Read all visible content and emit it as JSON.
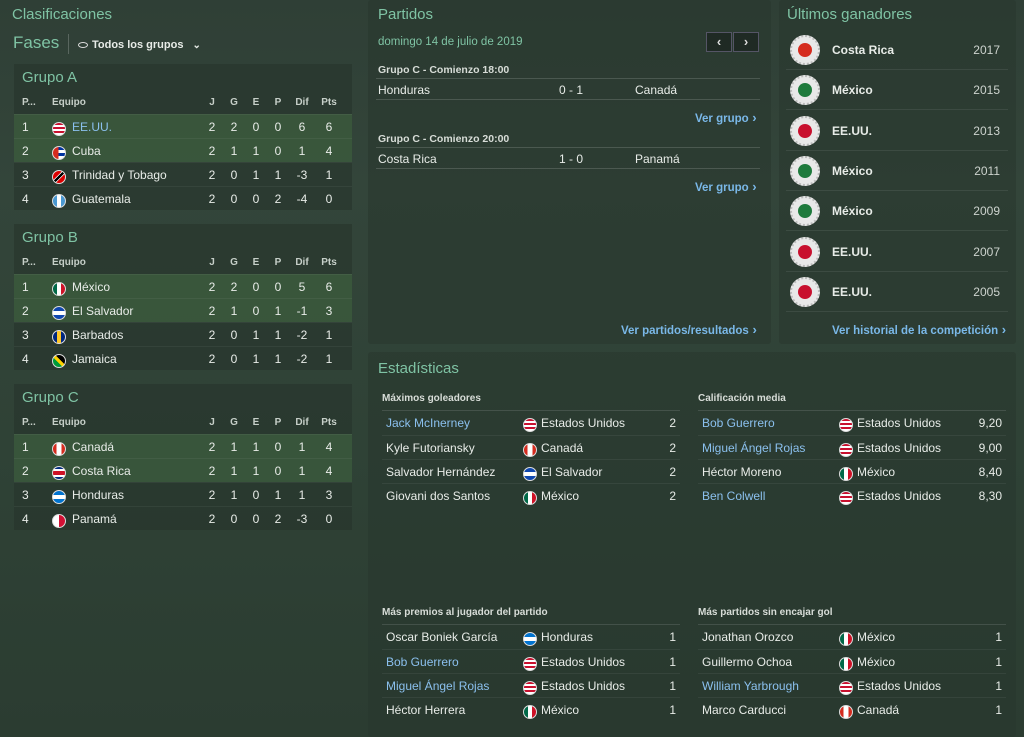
{
  "left": {
    "title": "Clasificaciones",
    "phases_label": "Fases",
    "filter_label": "Todos los grupos",
    "headers": {
      "pos": "P...",
      "team": "Equipo",
      "j": "J",
      "g": "G",
      "e": "E",
      "p": "P",
      "dif": "Dif",
      "pts": "Pts"
    },
    "groups": [
      {
        "name": "Grupo A",
        "rows": [
          {
            "pos": "1",
            "team": "EE.UU.",
            "flag": "usa",
            "j": "2",
            "g": "2",
            "e": "0",
            "p": "0",
            "dif": "6",
            "pts": "6",
            "q": true,
            "link": true
          },
          {
            "pos": "2",
            "team": "Cuba",
            "flag": "cuba",
            "j": "2",
            "g": "1",
            "e": "1",
            "p": "0",
            "dif": "1",
            "pts": "4",
            "q": true
          },
          {
            "pos": "3",
            "team": "Trinidad y Tobago",
            "flag": "tt",
            "j": "2",
            "g": "0",
            "e": "1",
            "p": "1",
            "dif": "-3",
            "pts": "1"
          },
          {
            "pos": "4",
            "team": "Guatemala",
            "flag": "gua",
            "j": "2",
            "g": "0",
            "e": "0",
            "p": "2",
            "dif": "-4",
            "pts": "0"
          }
        ]
      },
      {
        "name": "Grupo B",
        "rows": [
          {
            "pos": "1",
            "team": "México",
            "flag": "mex",
            "j": "2",
            "g": "2",
            "e": "0",
            "p": "0",
            "dif": "5",
            "pts": "6",
            "q": true
          },
          {
            "pos": "2",
            "team": "El Salvador",
            "flag": "slv",
            "j": "2",
            "g": "1",
            "e": "0",
            "p": "1",
            "dif": "-1",
            "pts": "3",
            "q": true
          },
          {
            "pos": "3",
            "team": "Barbados",
            "flag": "bar",
            "j": "2",
            "g": "0",
            "e": "1",
            "p": "1",
            "dif": "-2",
            "pts": "1"
          },
          {
            "pos": "4",
            "team": "Jamaica",
            "flag": "jam",
            "j": "2",
            "g": "0",
            "e": "1",
            "p": "1",
            "dif": "-2",
            "pts": "1"
          }
        ]
      },
      {
        "name": "Grupo C",
        "rows": [
          {
            "pos": "1",
            "team": "Canadá",
            "flag": "can",
            "j": "2",
            "g": "1",
            "e": "1",
            "p": "0",
            "dif": "1",
            "pts": "4",
            "q": true
          },
          {
            "pos": "2",
            "team": "Costa Rica",
            "flag": "crc",
            "j": "2",
            "g": "1",
            "e": "1",
            "p": "0",
            "dif": "1",
            "pts": "4",
            "q": true
          },
          {
            "pos": "3",
            "team": "Honduras",
            "flag": "hon",
            "j": "2",
            "g": "1",
            "e": "0",
            "p": "1",
            "dif": "1",
            "pts": "3"
          },
          {
            "pos": "4",
            "team": "Panamá",
            "flag": "pan",
            "j": "2",
            "g": "0",
            "e": "0",
            "p": "2",
            "dif": "-3",
            "pts": "0"
          }
        ]
      }
    ]
  },
  "matches": {
    "title": "Partidos",
    "date": "domingo 14 de julio de 2019",
    "prev": "‹",
    "next": "›",
    "games": [
      {
        "head": "Grupo C - Comienzo 18:00",
        "home": "Honduras",
        "score": "0 - 1",
        "away": "Canadá",
        "link": "Ver grupo"
      },
      {
        "head": "Grupo C - Comienzo 20:00",
        "home": "Costa Rica",
        "score": "1 - 0",
        "away": "Panamá",
        "link": "Ver grupo"
      }
    ],
    "all_link": "Ver partidos/resultados"
  },
  "winners": {
    "title": "Últimos ganadores",
    "rows": [
      {
        "team": "Costa Rica",
        "year": "2017",
        "color": "#d52b1e"
      },
      {
        "team": "México",
        "year": "2015",
        "color": "#1e7a3c"
      },
      {
        "team": "EE.UU.",
        "year": "2013",
        "color": "#c8102e"
      },
      {
        "team": "México",
        "year": "2011",
        "color": "#1e7a3c"
      },
      {
        "team": "México",
        "year": "2009",
        "color": "#1e7a3c"
      },
      {
        "team": "EE.UU.",
        "year": "2007",
        "color": "#c8102e"
      },
      {
        "team": "EE.UU.",
        "year": "2005",
        "color": "#c8102e"
      }
    ],
    "link": "Ver historial de la competición"
  },
  "stats": {
    "title": "Estadísticas",
    "blocks": [
      {
        "head": "Máximos goleadores",
        "rows": [
          {
            "name": "Jack McInerney",
            "flag": "usa",
            "nat": "Estados Unidos",
            "val": "2",
            "link": true
          },
          {
            "name": "Kyle Futoriansky",
            "flag": "can",
            "nat": "Canadá",
            "val": "2"
          },
          {
            "name": "Salvador Hernández",
            "flag": "slv",
            "nat": "El Salvador",
            "val": "2"
          },
          {
            "name": "Giovani dos Santos",
            "flag": "mex",
            "nat": "México",
            "val": "2"
          }
        ]
      },
      {
        "head": "Calificación media",
        "rows": [
          {
            "name": "Bob Guerrero",
            "flag": "usa",
            "nat": "Estados Unidos",
            "val": "9,20",
            "link": true
          },
          {
            "name": "Miguel Ángel Rojas",
            "flag": "usa",
            "nat": "Estados Unidos",
            "val": "9,00",
            "link": true
          },
          {
            "name": "Héctor Moreno",
            "flag": "mex",
            "nat": "México",
            "val": "8,40"
          },
          {
            "name": "Ben Colwell",
            "flag": "usa",
            "nat": "Estados Unidos",
            "val": "8,30",
            "link": true
          }
        ]
      },
      {
        "head": "Más premios al jugador del partido",
        "rows": [
          {
            "name": "Oscar Boniek García",
            "flag": "hon",
            "nat": "Honduras",
            "val": "1"
          },
          {
            "name": "Bob Guerrero",
            "flag": "usa",
            "nat": "Estados Unidos",
            "val": "1",
            "link": true
          },
          {
            "name": "Miguel Ángel Rojas",
            "flag": "usa",
            "nat": "Estados Unidos",
            "val": "1",
            "link": true
          },
          {
            "name": "Héctor Herrera",
            "flag": "mex",
            "nat": "México",
            "val": "1"
          }
        ]
      },
      {
        "head": "Más partidos sin encajar gol",
        "rows": [
          {
            "name": "Jonathan Orozco",
            "flag": "mex",
            "nat": "México",
            "val": "1"
          },
          {
            "name": "Guillermo Ochoa",
            "flag": "mex",
            "nat": "México",
            "val": "1"
          },
          {
            "name": "William Yarbrough",
            "flag": "usa",
            "nat": "Estados Unidos",
            "val": "1",
            "link": true
          },
          {
            "name": "Marco Carducci",
            "flag": "can",
            "nat": "Canadá",
            "val": "1"
          }
        ]
      }
    ]
  }
}
